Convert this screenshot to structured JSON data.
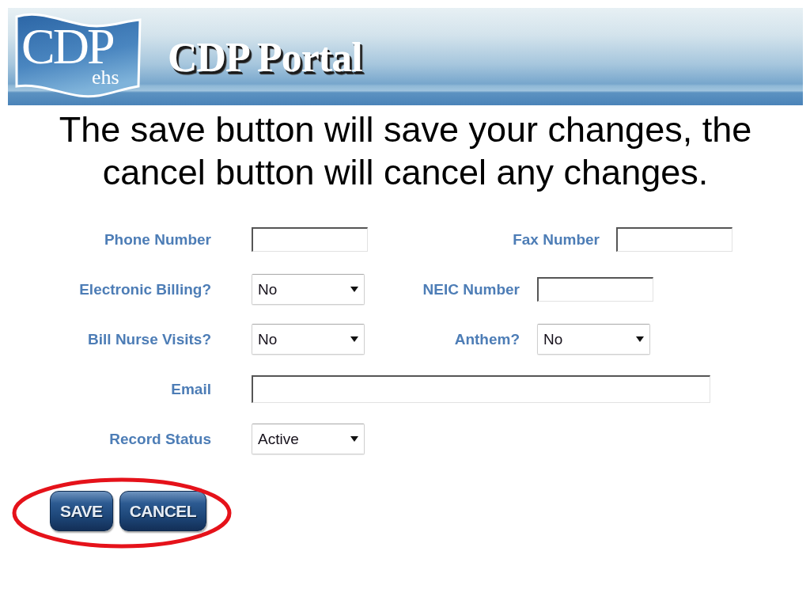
{
  "header": {
    "logo": {
      "text": "CDP",
      "subtext": "ehs"
    },
    "title": "CDP Portal"
  },
  "instruction": "The save button will save your changes, the cancel button will cancel any changes.",
  "form": {
    "rows": [
      {
        "fields": [
          {
            "label": "Phone Number",
            "kind": "text"
          },
          {
            "label": "Fax Number",
            "kind": "text"
          }
        ]
      },
      {
        "fields": [
          {
            "label": "Electronic Billing?",
            "kind": "select",
            "value": "No"
          },
          {
            "label": "NEIC Number",
            "kind": "text"
          }
        ]
      },
      {
        "fields": [
          {
            "label": "Bill Nurse Visits?",
            "kind": "select",
            "value": "No"
          },
          {
            "label": "Anthem?",
            "kind": "select",
            "value": "No"
          }
        ]
      },
      {
        "fields": [
          {
            "label": "Email",
            "kind": "text"
          }
        ]
      },
      {
        "fields": [
          {
            "label": "Record Status",
            "kind": "select",
            "value": "Active"
          }
        ]
      }
    ]
  },
  "button_bar": {
    "circled": true,
    "buttons": [
      {
        "label": "SAVE"
      },
      {
        "label": "CANCEL"
      }
    ]
  }
}
